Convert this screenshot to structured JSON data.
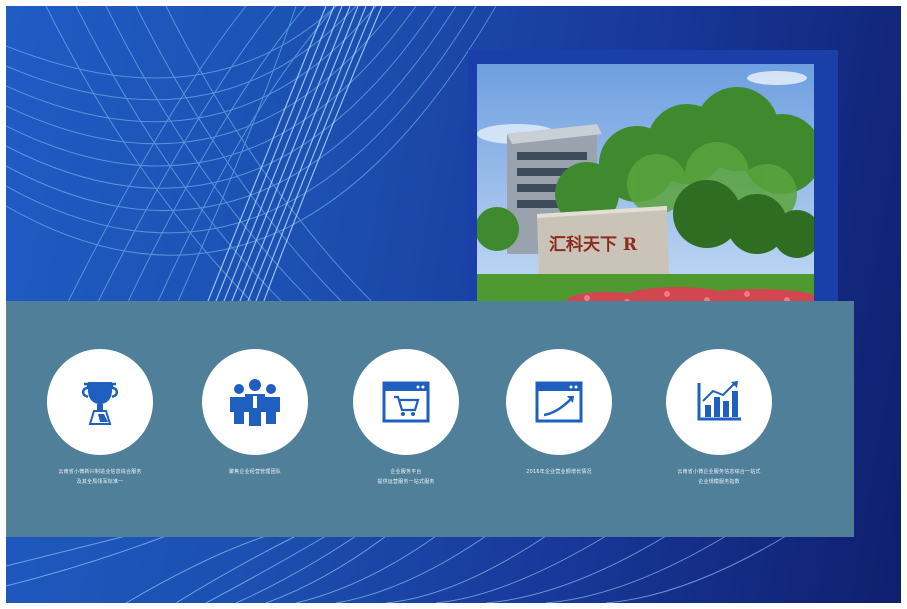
{
  "colors": {
    "background_blue": "#1c4fb0",
    "panel_teal": "#4f7f99",
    "icon_blue": "#1f5fbf"
  },
  "photo": {
    "sign_text": "汇科天下 R"
  },
  "features": [
    {
      "icon": "trophy-icon",
      "caption_line1": "云南省小微新兴制造业信息综合服务",
      "caption_line2": "及其全局领军标准一"
    },
    {
      "icon": "team-icon",
      "caption_line1": "聚焦企业经营管理团队",
      "caption_line2": ""
    },
    {
      "icon": "shopping-cart-window-icon",
      "caption_line1": "企业服务平台",
      "caption_line2": "提供运营服务一站式服务"
    },
    {
      "icon": "trend-window-icon",
      "caption_line1": "2016年企业营业额增长情况",
      "caption_line2": ""
    },
    {
      "icon": "bar-chart-icon",
      "caption_line1": "云南省小微企业服务信息综合一站式",
      "caption_line2": "企业规模服务指数"
    }
  ]
}
